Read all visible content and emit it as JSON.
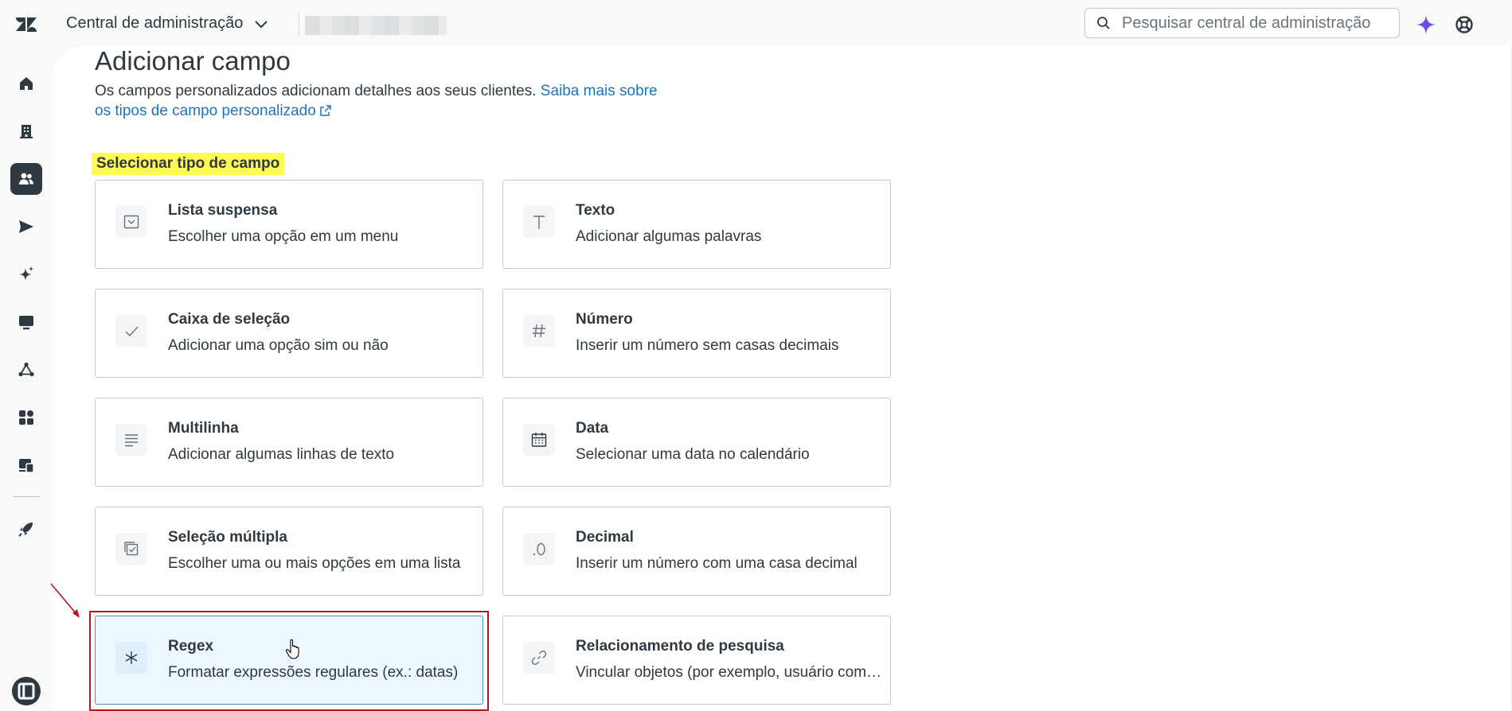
{
  "header": {
    "product_title": "Central de administração",
    "search_placeholder": "Pesquisar central de administração"
  },
  "sidebar": {
    "items": [
      {
        "icon": "home-icon"
      },
      {
        "icon": "building-icon"
      },
      {
        "icon": "people-icon",
        "active": true
      },
      {
        "icon": "send-icon"
      },
      {
        "icon": "sparkle-icon"
      },
      {
        "icon": "monitor-icon"
      },
      {
        "icon": "objects-icon"
      },
      {
        "icon": "apps-icon"
      },
      {
        "icon": "workspace-icon"
      },
      {
        "icon": "rocket-icon"
      },
      {
        "icon": "panel-toggle-icon"
      }
    ]
  },
  "main": {
    "title": "Adicionar campo",
    "description": "Os campos personalizados adicionam detalhes aos seus clientes.",
    "learn_more_link": "Saiba mais sobre os tipos de campo personalizado",
    "section_label": "Selecionar tipo de campo",
    "field_types": [
      {
        "title": "Lista suspensa",
        "desc": "Escolher uma opção em um menu",
        "icon": "dropdown-icon"
      },
      {
        "title": "Texto",
        "desc": "Adicionar algumas palavras",
        "icon": "text-icon"
      },
      {
        "title": "Caixa de seleção",
        "desc": "Adicionar uma opção sim ou não",
        "icon": "checkmark-icon"
      },
      {
        "title": "Número",
        "desc": "Inserir um número sem casas decimais",
        "icon": "hash-icon"
      },
      {
        "title": "Multilinha",
        "desc": "Adicionar algumas linhas de texto",
        "icon": "lines-icon"
      },
      {
        "title": "Data",
        "desc": "Selecionar uma data no calendário",
        "icon": "calendar-icon"
      },
      {
        "title": "Seleção múltipla",
        "desc": "Escolher uma ou mais opções em uma lista",
        "icon": "multi-select-icon"
      },
      {
        "title": "Decimal",
        "desc": "Inserir um número com uma casa decimal",
        "icon": "decimal-icon"
      },
      {
        "title": "Regex",
        "desc": "Formatar expressões regulares (ex.: datas)",
        "icon": "asterisk-icon",
        "selected": true
      },
      {
        "title": "Relacionamento de pesquisa",
        "desc": "Vincular objetos (por exemplo, usuário com organização)",
        "icon": "link-icon"
      }
    ]
  },
  "colors": {
    "link": "#1f73b7",
    "highlight": "#fffb52",
    "annotation": "#b0181e",
    "ai_accent": "#6e4ae0"
  }
}
